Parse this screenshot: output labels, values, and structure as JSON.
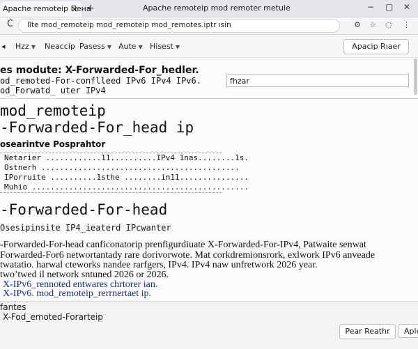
{
  "tab": {
    "title": "Apache remoteip Пена",
    "close": "×",
    "new": "+"
  },
  "window": {
    "title": "Apache remoteip mod remoter metule",
    "minimize": "−",
    "maximize": "▢",
    "close": "✕"
  },
  "address": {
    "reload": "C",
    "url": "llte mod_remoteip mod_remoteip mod_remotes.iptr ısin"
  },
  "toolbar": {
    "back": "◂",
    "items": [
      "Hzz",
      "Neaccip",
      "Pasess",
      "Aute",
      "Hisest"
    ],
    "button": "Apacip Rıaer"
  },
  "section1": {
    "heading": "es modute: X-Forwarded-For_hedler.",
    "line1": "od_remoted-For-conflleed IPv6  IPv4 IPv6.",
    "line2": "od_Forwatd_ uter IPv4",
    "filter_value": "fhzar"
  },
  "title_big": {
    "line1": "mod_remoteip",
    "line2": "-Forwarded-For_head ip"
  },
  "subsection": {
    "heading": "osearintve Posprahtor",
    "rows": [
      "Netarier ............11..........IPv4  1nas........1s.",
      "Ostnerh ...........................................",
      "IPorruite ..........1sthe ........in11...............",
      "Muhio ..............................................."
    ]
  },
  "section2": {
    "heading": "-Forwarded-For-head",
    "subheading": "Osesipinsite IP4_ieaterd IPcwanter",
    "para1": "-Forwarded-For-head canficonatorip prenfigurdiuate X-Forwarded-For-IPv4, Patwaite senwat",
    "para2": "Forwarded-For6 networtantady rare dorivorwote. Mat corkdremionsrork, exlwork IPv6 anveade",
    "para3": "twatatio. harwal cteworks nandee rarfgers, IPv4.   IPv4 naw  unfretwork 2026 year.",
    "para4": "two’twed il network sntuned 2026 or 2026.",
    "link1": "X-IPv6_rennoted entwares chrtorer ian.",
    "link2": "X-IPv6.  mod_remoteip_rerrnertaet ip."
  },
  "footer": {
    "label": "fantes",
    "value": "X-Fod_emoted-Forarteip",
    "prev_button": "Pear Reathr",
    "apply_button": "Aple"
  }
}
